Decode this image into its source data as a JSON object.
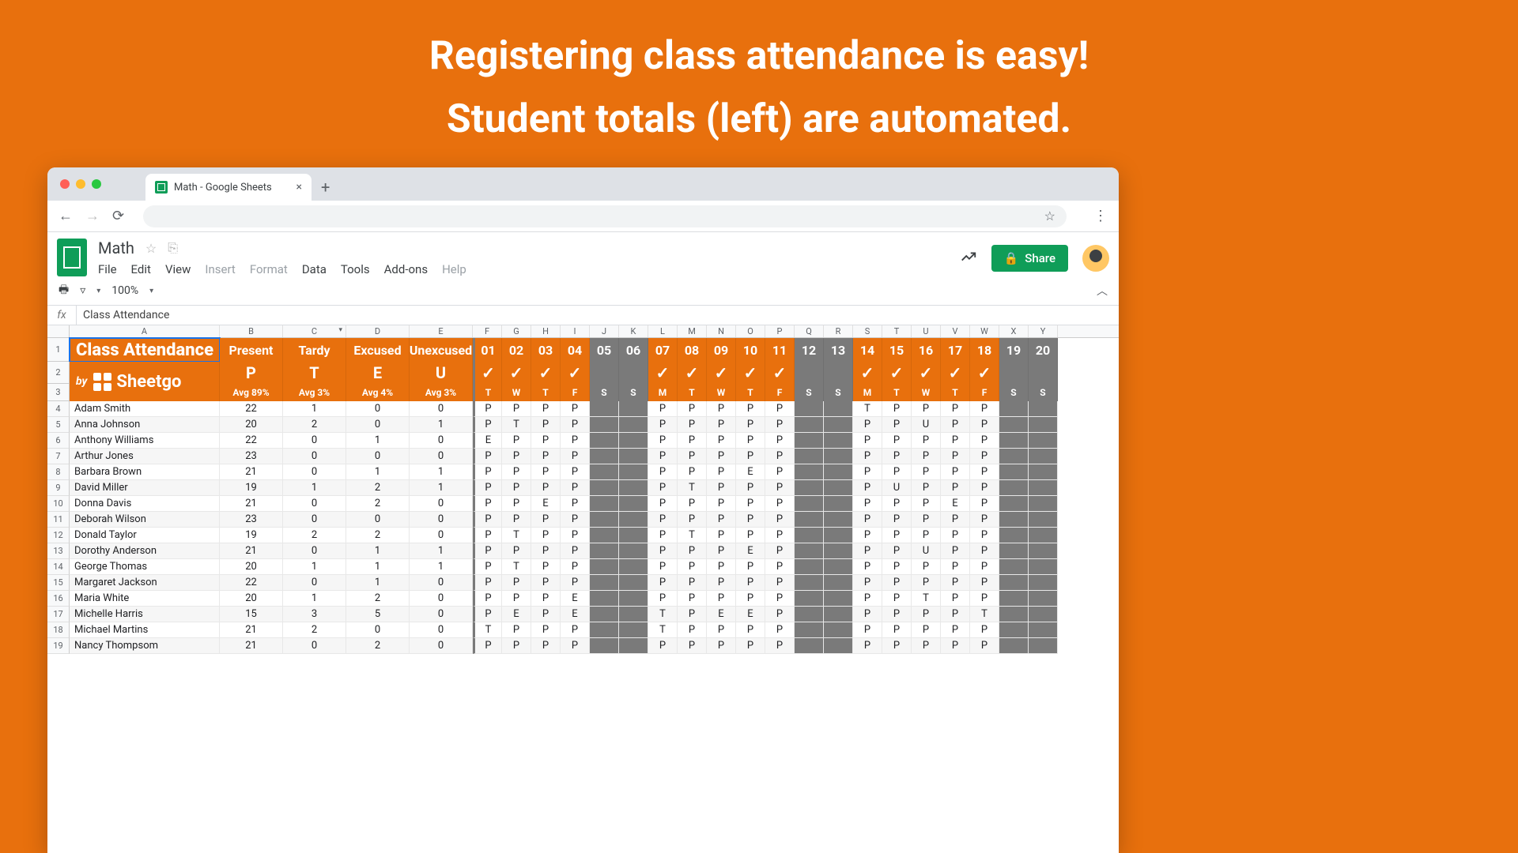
{
  "hero": {
    "line1": "Registering class attendance is easy!",
    "line2": "Student totals (left) are automated."
  },
  "browser": {
    "tab_title": "Math - Google Sheets"
  },
  "doc": {
    "title": "Math",
    "menubar": [
      "File",
      "Edit",
      "View",
      "Insert",
      "Format",
      "Data",
      "Tools",
      "Add-ons",
      "Help"
    ],
    "share": "Share",
    "zoom": "100%",
    "fx_value": "Class Attendance"
  },
  "columns": [
    "A",
    "B",
    "C",
    "D",
    "E",
    "F",
    "G",
    "H",
    "I",
    "J",
    "K",
    "L",
    "M",
    "N",
    "O",
    "P",
    "Q",
    "R",
    "S",
    "T",
    "U",
    "V",
    "W",
    "X",
    "Y"
  ],
  "header": {
    "title": "Class Attendance",
    "brand_by": "by",
    "brand_name": "Sheetgo",
    "stats": [
      {
        "label": "Present",
        "code": "P",
        "avg": "Avg 89%"
      },
      {
        "label": "Tardy",
        "code": "T",
        "avg": "Avg 3%"
      },
      {
        "label": "Excused",
        "code": "E",
        "avg": "Avg 4%"
      },
      {
        "label": "Unexcused",
        "code": "U",
        "avg": "Avg 3%"
      }
    ],
    "days": [
      {
        "num": "01",
        "wd": "T",
        "type": "school"
      },
      {
        "num": "02",
        "wd": "W",
        "type": "school"
      },
      {
        "num": "03",
        "wd": "T",
        "type": "school"
      },
      {
        "num": "04",
        "wd": "F",
        "type": "school"
      },
      {
        "num": "05",
        "wd": "S",
        "type": "weekend"
      },
      {
        "num": "06",
        "wd": "S",
        "type": "weekend"
      },
      {
        "num": "07",
        "wd": "M",
        "type": "school"
      },
      {
        "num": "08",
        "wd": "T",
        "type": "school"
      },
      {
        "num": "09",
        "wd": "W",
        "type": "school"
      },
      {
        "num": "10",
        "wd": "T",
        "type": "school"
      },
      {
        "num": "11",
        "wd": "F",
        "type": "school"
      },
      {
        "num": "12",
        "wd": "S",
        "type": "weekend"
      },
      {
        "num": "13",
        "wd": "S",
        "type": "weekend"
      },
      {
        "num": "14",
        "wd": "M",
        "type": "school"
      },
      {
        "num": "15",
        "wd": "T",
        "type": "school"
      },
      {
        "num": "16",
        "wd": "W",
        "type": "school"
      },
      {
        "num": "17",
        "wd": "T",
        "type": "school"
      },
      {
        "num": "18",
        "wd": "F",
        "type": "school"
      },
      {
        "num": "19",
        "wd": "S",
        "type": "weekend"
      },
      {
        "num": "20",
        "wd": "S",
        "type": "weekend"
      }
    ]
  },
  "rows": [
    {
      "n": 4,
      "name": "Adam Smith",
      "p": 22,
      "t": 1,
      "e": 0,
      "u": 0,
      "d": [
        "P",
        "P",
        "P",
        "P",
        "",
        "",
        "P",
        "P",
        "P",
        "P",
        "P",
        "",
        "",
        "T",
        "P",
        "P",
        "P",
        "P",
        "",
        ""
      ]
    },
    {
      "n": 5,
      "name": "Anna Johnson",
      "p": 20,
      "t": 2,
      "e": 0,
      "u": 1,
      "d": [
        "P",
        "T",
        "P",
        "P",
        "",
        "",
        "P",
        "P",
        "P",
        "P",
        "P",
        "",
        "",
        "P",
        "P",
        "U",
        "P",
        "P",
        "",
        ""
      ]
    },
    {
      "n": 6,
      "name": "Anthony Williams",
      "p": 22,
      "t": 0,
      "e": 1,
      "u": 0,
      "d": [
        "E",
        "P",
        "P",
        "P",
        "",
        "",
        "P",
        "P",
        "P",
        "P",
        "P",
        "",
        "",
        "P",
        "P",
        "P",
        "P",
        "P",
        "",
        ""
      ]
    },
    {
      "n": 7,
      "name": "Arthur Jones",
      "p": 23,
      "t": 0,
      "e": 0,
      "u": 0,
      "d": [
        "P",
        "P",
        "P",
        "P",
        "",
        "",
        "P",
        "P",
        "P",
        "P",
        "P",
        "",
        "",
        "P",
        "P",
        "P",
        "P",
        "P",
        "",
        ""
      ]
    },
    {
      "n": 8,
      "name": "Barbara Brown",
      "p": 21,
      "t": 0,
      "e": 1,
      "u": 1,
      "d": [
        "P",
        "P",
        "P",
        "P",
        "",
        "",
        "P",
        "P",
        "P",
        "E",
        "P",
        "",
        "",
        "P",
        "P",
        "P",
        "P",
        "P",
        "",
        ""
      ]
    },
    {
      "n": 9,
      "name": "David Miller",
      "p": 19,
      "t": 1,
      "e": 2,
      "u": 1,
      "d": [
        "P",
        "P",
        "P",
        "P",
        "",
        "",
        "P",
        "T",
        "P",
        "P",
        "P",
        "",
        "",
        "P",
        "U",
        "P",
        "P",
        "P",
        "",
        ""
      ]
    },
    {
      "n": 10,
      "name": "Donna Davis",
      "p": 21,
      "t": 0,
      "e": 2,
      "u": 0,
      "d": [
        "P",
        "P",
        "E",
        "P",
        "",
        "",
        "P",
        "P",
        "P",
        "P",
        "P",
        "",
        "",
        "P",
        "P",
        "P",
        "E",
        "P",
        "",
        ""
      ]
    },
    {
      "n": 11,
      "name": "Deborah Wilson",
      "p": 23,
      "t": 0,
      "e": 0,
      "u": 0,
      "d": [
        "P",
        "P",
        "P",
        "P",
        "",
        "",
        "P",
        "P",
        "P",
        "P",
        "P",
        "",
        "",
        "P",
        "P",
        "P",
        "P",
        "P",
        "",
        ""
      ]
    },
    {
      "n": 12,
      "name": "Donald Taylor",
      "p": 19,
      "t": 2,
      "e": 2,
      "u": 0,
      "d": [
        "P",
        "T",
        "P",
        "P",
        "",
        "",
        "P",
        "T",
        "P",
        "P",
        "P",
        "",
        "",
        "P",
        "P",
        "P",
        "P",
        "P",
        "",
        ""
      ]
    },
    {
      "n": 13,
      "name": "Dorothy Anderson",
      "p": 21,
      "t": 0,
      "e": 1,
      "u": 1,
      "d": [
        "P",
        "P",
        "P",
        "P",
        "",
        "",
        "P",
        "P",
        "P",
        "E",
        "P",
        "",
        "",
        "P",
        "P",
        "U",
        "P",
        "P",
        "",
        ""
      ]
    },
    {
      "n": 14,
      "name": "George Thomas",
      "p": 20,
      "t": 1,
      "e": 1,
      "u": 1,
      "d": [
        "P",
        "T",
        "P",
        "P",
        "",
        "",
        "P",
        "P",
        "P",
        "P",
        "P",
        "",
        "",
        "P",
        "P",
        "P",
        "P",
        "P",
        "",
        ""
      ]
    },
    {
      "n": 15,
      "name": "Margaret Jackson",
      "p": 22,
      "t": 0,
      "e": 1,
      "u": 0,
      "d": [
        "P",
        "P",
        "P",
        "P",
        "",
        "",
        "P",
        "P",
        "P",
        "P",
        "P",
        "",
        "",
        "P",
        "P",
        "P",
        "P",
        "P",
        "",
        ""
      ]
    },
    {
      "n": 16,
      "name": "Maria White",
      "p": 20,
      "t": 1,
      "e": 2,
      "u": 0,
      "d": [
        "P",
        "P",
        "P",
        "E",
        "",
        "",
        "P",
        "P",
        "P",
        "P",
        "P",
        "",
        "",
        "P",
        "P",
        "T",
        "P",
        "P",
        "",
        ""
      ]
    },
    {
      "n": 17,
      "name": "Michelle Harris",
      "p": 15,
      "t": 3,
      "e": 5,
      "u": 0,
      "d": [
        "P",
        "E",
        "P",
        "E",
        "",
        "",
        "T",
        "P",
        "E",
        "E",
        "P",
        "",
        "",
        "P",
        "P",
        "P",
        "P",
        "T",
        "",
        ""
      ]
    },
    {
      "n": 18,
      "name": "Michael Martins",
      "p": 21,
      "t": 2,
      "e": 0,
      "u": 0,
      "d": [
        "T",
        "P",
        "P",
        "P",
        "",
        "",
        "T",
        "P",
        "P",
        "P",
        "P",
        "",
        "",
        "P",
        "P",
        "P",
        "P",
        "P",
        "",
        ""
      ]
    },
    {
      "n": 19,
      "name": "Nancy Thompsom",
      "p": 21,
      "t": 0,
      "e": 2,
      "u": 0,
      "d": [
        "P",
        "P",
        "P",
        "P",
        "",
        "",
        "P",
        "P",
        "P",
        "P",
        "P",
        "",
        "",
        "P",
        "P",
        "P",
        "P",
        "P",
        "",
        ""
      ]
    }
  ]
}
